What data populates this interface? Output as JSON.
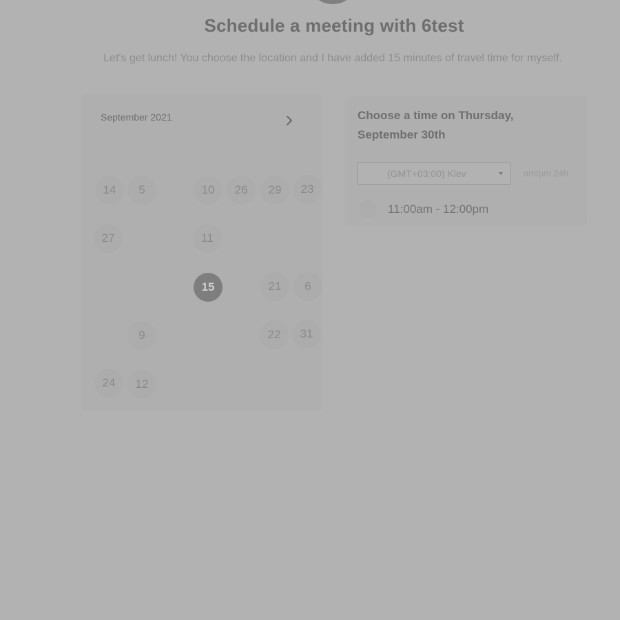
{
  "header": {
    "title": "Schedule a meeting with 6test",
    "subtitle": "Let's get lunch! You choose the location and I have added 15 minutes of travel time for myself."
  },
  "calendar": {
    "month_label": "September 2021",
    "next_icon": "chevron-right-icon",
    "selected_day": "15",
    "days": [
      "14",
      "5",
      "10",
      "26",
      "29",
      "23",
      "27",
      "11",
      "15",
      "21",
      "6",
      "9",
      "22",
      "31",
      "24",
      "12"
    ]
  },
  "times": {
    "heading": "Choose a time on Thursday, September 30th",
    "timezone_value": "(GMT+03:00) Kiev",
    "format_toggle": "am/pm  24h",
    "slots": [
      "11:00am - 12:00pm"
    ]
  },
  "colors": {
    "overlay": "#b2b2b2",
    "selected_day": "#7e7e7e"
  }
}
